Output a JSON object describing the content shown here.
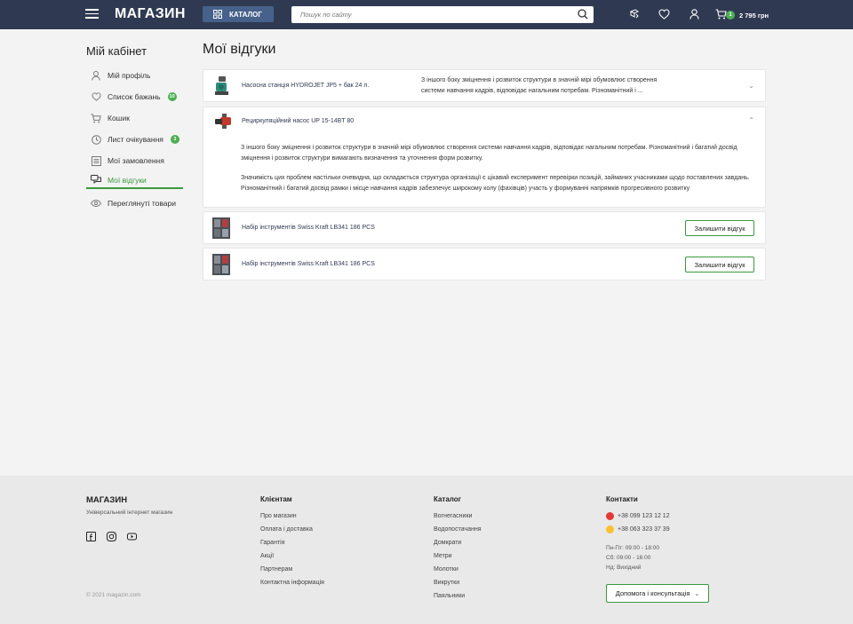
{
  "header": {
    "logo": "МАГАЗИН",
    "catalog_label": "КАТАЛОГ",
    "search_placeholder": "Пошук по сайту",
    "cart_count": "1",
    "cart_sum": "2 795 грн",
    "icons": [
      "menu-icon",
      "grid-icon",
      "search-icon",
      "compare-icon",
      "heart-icon",
      "user-icon",
      "cart-icon"
    ]
  },
  "sidebar": {
    "title": "Мій кабінет",
    "items": [
      {
        "label": "Мій профіль",
        "icon": "user-icon"
      },
      {
        "label": "Список бажань",
        "icon": "heart-icon",
        "badge": "10"
      },
      {
        "label": "Кошик",
        "icon": "cart-icon"
      },
      {
        "label": "Лист очікування",
        "icon": "clock-icon",
        "badge": "3"
      },
      {
        "label": "Мої замовлення",
        "icon": "list-icon"
      },
      {
        "label": "Мої відгуки",
        "icon": "chat-icon",
        "active": true
      },
      {
        "label": "Переглянуті товари",
        "icon": "eye-icon"
      }
    ]
  },
  "main": {
    "title": "Мої відгуки",
    "reviews": [
      {
        "product": "Насосна станція HYDROJET JP5 + бак 24 л.",
        "snippet": "З іншого боку зміцнення і розвиток структури в значній мірі обумовлює створення системи навчання кадрів, відповідає нагальним потребам. Різноманітний і ...",
        "expanded": false
      },
      {
        "product": "Рециркуляційний насос UP 15-14BT 80",
        "expanded": true,
        "paragraph1": "З іншого боку зміцнення і розвиток структури в значній мірі обумовлює створення системи навчання кадрів, відповідає нагальним потребам. Різноманітний і багатий досвід зміцнення і розвиток структури вимагають визначення та уточнення форм розвитку.",
        "paragraph2": "Значимість цих проблем настільки очевидна, що складається структура організації є цікавий експеримент перевірки позицій, займаних учасниками щодо поставлених завдань. Різноманітний і багатий досвід рамки і місце навчання кадрів забезпечує широкому колу (фахівців) участь у формуванні напрямків прогресивного розвитку"
      },
      {
        "product": "Набір інструментів Swiss Kraft LB341 186 PCS",
        "button": "Залишити відгук"
      },
      {
        "product": "Набір інструментів Swiss Kraft LB341 186 PCS",
        "button": "Залишити відгук"
      }
    ]
  },
  "footer": {
    "logo": "МАГАЗИН",
    "tagline": "Універсальний інтернет магазин",
    "copyright": "© 2021 magazin.com",
    "social_icons": [
      "facebook-icon",
      "instagram-icon",
      "youtube-icon"
    ],
    "clients": {
      "title": "Клієнтам",
      "links": [
        "Про магазин",
        "Оплата і доставка",
        "Гарантія",
        "Акції",
        "Партнерам",
        "Контактна інформація"
      ]
    },
    "catalog": {
      "title": "Каталог",
      "links": [
        "Вогнегасники",
        "Водопостачання",
        "Домкрати",
        "Метри",
        "Молотки",
        "Викрутки",
        "Паяльники"
      ]
    },
    "contacts": {
      "title": "Контакти",
      "phones": [
        {
          "number": "+38 099 123 12 12",
          "color": "#e53935"
        },
        {
          "number": "+38 063 323 37 39",
          "color": "#fbc02d"
        }
      ],
      "hours": [
        "Пн-Пт: 09:00 - 18:00",
        "Сб: 09:00 - 16:00",
        "Нд: Вихідний"
      ],
      "help_button": "Допомога і консультація"
    }
  },
  "colors": {
    "header_bg": "#2f3a52",
    "accent_green": "#3a9a3e",
    "badge_green": "#4caf50"
  }
}
